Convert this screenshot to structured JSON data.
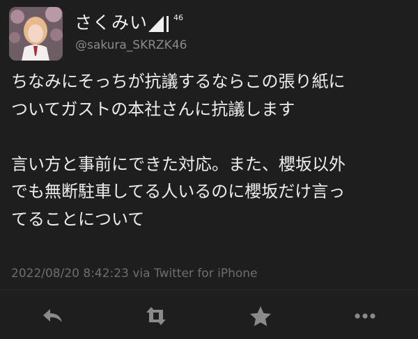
{
  "tweet": {
    "display_name": "さくみい",
    "name_badge": {
      "label": "46",
      "icon": "sakurazaka46-logo-icon"
    },
    "handle": "@sakura_SKRZK46",
    "paragraphs": [
      [
        "ちなみにそっちが抗議するならこの張り紙に",
        "ついてガストの本社さんに抗議します"
      ],
      [
        "言い方と事前にできた対応。また、櫻坂以外",
        "でも無断駐車してる人いるのに櫻坂だけ言っ",
        "てることについて"
      ]
    ],
    "timestamp": "2022/08/20 8:42:23",
    "via": "via Twitter for iPhone"
  },
  "actions": [
    {
      "name": "reply",
      "icon": "reply-icon"
    },
    {
      "name": "retweet",
      "icon": "retweet-icon"
    },
    {
      "name": "favorite",
      "icon": "star-icon"
    },
    {
      "name": "more",
      "icon": "more-icon"
    }
  ],
  "colors": {
    "background": "#1e1e1e",
    "text": "#ededed",
    "secondary_text": "#8a8a8a",
    "icon": "#8a8a8a"
  }
}
